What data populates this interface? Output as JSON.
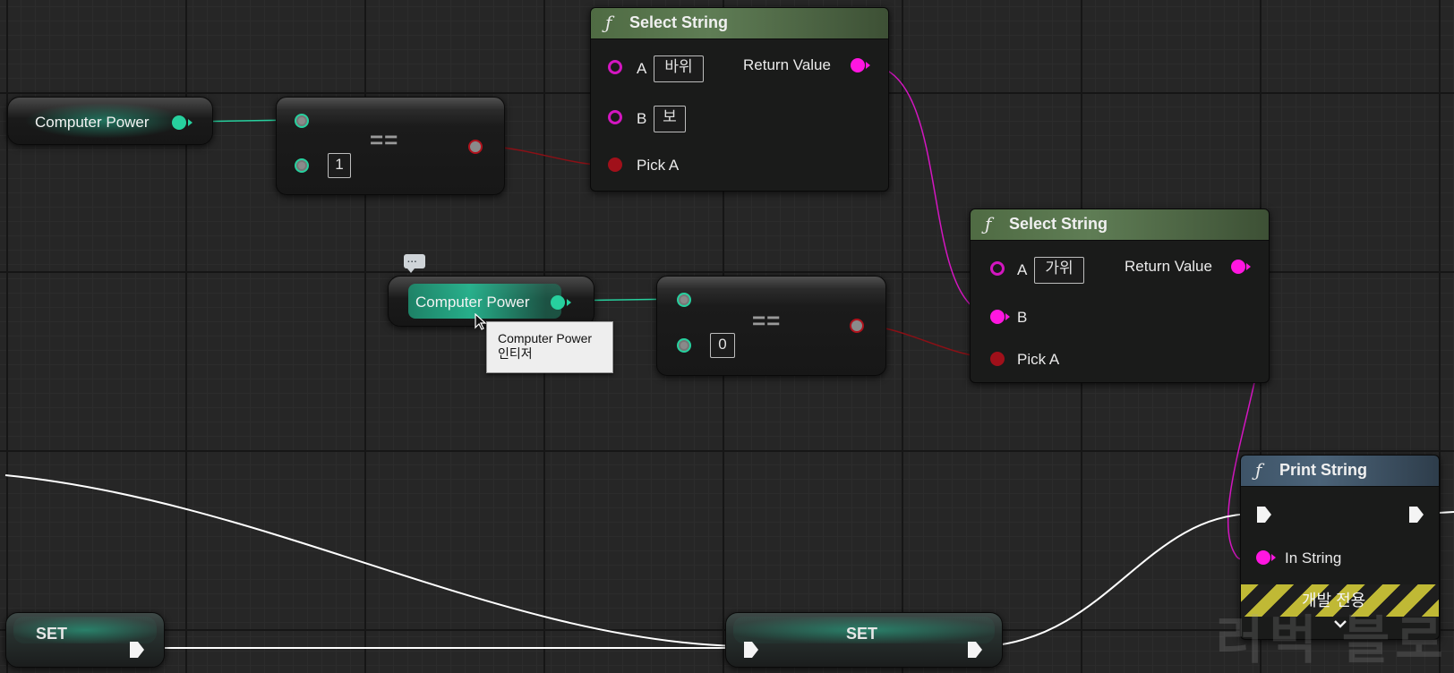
{
  "nodes": {
    "get1": {
      "label": "Computer Power"
    },
    "get2": {
      "label": "Computer Power"
    },
    "eq1": {
      "symbol": "==",
      "value": "1"
    },
    "eq2": {
      "symbol": "==",
      "value": "0"
    },
    "select1": {
      "icon": "function-icon",
      "title": "Select String",
      "pin_a": "A",
      "value_a": "바위",
      "pin_b": "B",
      "value_b": "보",
      "pin_pick": "Pick A",
      "return": "Return Value"
    },
    "select2": {
      "icon": "function-icon",
      "title": "Select String",
      "pin_a": "A",
      "value_a": "가위",
      "pin_b": "B",
      "pin_pick": "Pick A",
      "return": "Return Value"
    },
    "print": {
      "icon": "function-icon",
      "title": "Print String",
      "pin_in": "In String",
      "dev_only": "개발 전용",
      "expand_icon": "chevron-down-icon"
    },
    "set1": {
      "label": "SET"
    },
    "set2": {
      "label": "SET"
    }
  },
  "tooltip": {
    "line1": "Computer Power",
    "line2": "인티저"
  },
  "comment_bubble": "...",
  "watermark": "러벅 블로",
  "colors": {
    "background": "#262626",
    "integer_pin": "#27d09e",
    "bool_pin": "#a0101a",
    "string_pin": "#ff16e0",
    "exec_wire": "#ffffff",
    "pure_function_header": "#5f7d55",
    "impure_function_header": "#4b6378"
  }
}
